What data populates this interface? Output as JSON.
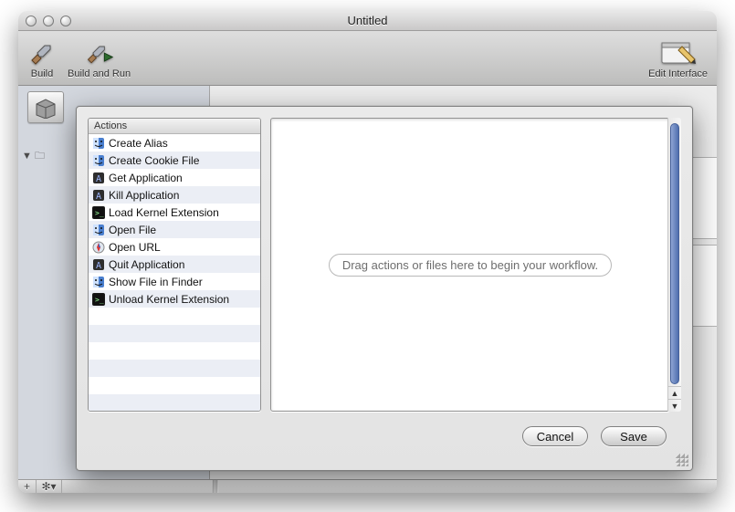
{
  "window": {
    "title": "Untitled"
  },
  "toolbar": {
    "build": "Build",
    "build_run": "Build and Run",
    "edit_interface": "Edit Interface"
  },
  "sidebar": {
    "disclosure_label": "🗀"
  },
  "bottombar": {
    "plus": "+",
    "gear": "✻▾"
  },
  "sheet": {
    "panel_title": "Actions",
    "drop_message": "Drag actions or files here to begin your workflow.",
    "cancel": "Cancel",
    "save": "Save",
    "actions": [
      {
        "label": "Create Alias",
        "icon": "finder"
      },
      {
        "label": "Create Cookie File",
        "icon": "finder"
      },
      {
        "label": "Get Application",
        "icon": "app"
      },
      {
        "label": "Kill Application",
        "icon": "app"
      },
      {
        "label": "Load Kernel Extension",
        "icon": "term"
      },
      {
        "label": "Open File",
        "icon": "finder"
      },
      {
        "label": "Open URL",
        "icon": "safari"
      },
      {
        "label": "Quit Application",
        "icon": "app"
      },
      {
        "label": "Show File in Finder",
        "icon": "finder"
      },
      {
        "label": "Unload Kernel Extension",
        "icon": "term"
      }
    ]
  }
}
